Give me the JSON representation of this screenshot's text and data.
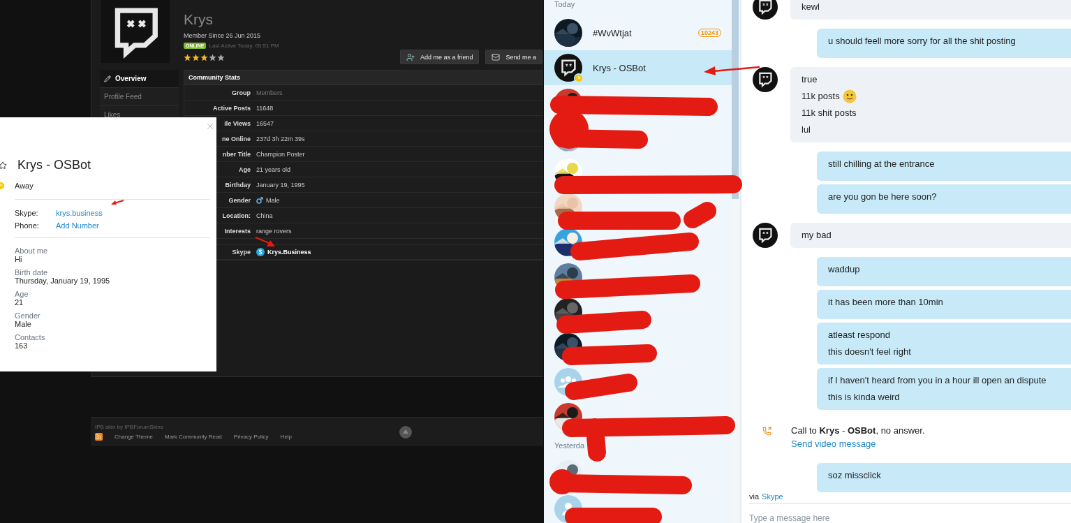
{
  "forum": {
    "username": "Krys",
    "member_since": "Member Since 26 Jun 2015",
    "online": true,
    "status_badge": "ONLINE",
    "last_active": "Last Active Today, 05:51 PM",
    "stars": 3,
    "buttons": [
      {
        "label": "Add me as a friend",
        "kind": "friend"
      },
      {
        "label": "Send me a",
        "kind": "message"
      }
    ],
    "sidebar": [
      {
        "label": "Overview",
        "selected": true
      },
      {
        "label": "Profile Feed",
        "selected": false
      },
      {
        "label": "Likes",
        "selected": false
      }
    ],
    "stats": {
      "title": "Community Stats",
      "rows": [
        {
          "label": "Group",
          "value": "Members",
          "kind": "muted"
        },
        {
          "label": "Active Posts",
          "value": "11648",
          "kind": "plain"
        },
        {
          "label": "ile Views",
          "value": "16547",
          "kind": "plain"
        },
        {
          "label": "ne Online",
          "value": "237d 3h 22m 39s",
          "kind": "plain"
        },
        {
          "label": "nber Title",
          "value": "Champion Poster",
          "kind": "plain"
        },
        {
          "label": "Age",
          "value": "21 years old",
          "kind": "plain"
        },
        {
          "label": "Birthday",
          "value": "January 19, 1995",
          "kind": "plain"
        },
        {
          "label": "Gender",
          "value": "Male",
          "kind": "gender"
        },
        {
          "label": "Location:",
          "value": "China",
          "kind": "plain"
        },
        {
          "label": "Interests",
          "value": "range rovers",
          "kind": "plain"
        },
        {
          "label": "Skype",
          "value": "Krys.Business",
          "kind": "skype"
        }
      ]
    },
    "footer": {
      "credit": "IPB skin by IPBForumSkins",
      "links": [
        "Change Theme",
        "Mark Community Read",
        "Privacy Policy",
        "Help"
      ]
    }
  },
  "profile_card": {
    "name": "Krys - OSBot",
    "status": "Away",
    "contacts": [
      {
        "label": "Skype:",
        "value": "krys.business"
      },
      {
        "label": "Phone:",
        "value": "Add Number"
      }
    ],
    "fields": [
      {
        "label": "About me",
        "value": "Hi"
      },
      {
        "label": "Birth date",
        "value": "Thursday, January 19, 1995"
      },
      {
        "label": "Age",
        "value": "21"
      },
      {
        "label": "Gender",
        "value": "Male"
      },
      {
        "label": "Contacts",
        "value": "163"
      }
    ]
  },
  "contacts": {
    "today_label": "Today",
    "today": [
      {
        "name": "#WvWtjat",
        "badge": "10243",
        "kind": "picture",
        "selected": false,
        "away": false
      },
      {
        "name": "Krys - OSBot",
        "kind": "logo",
        "selected": true,
        "away": true
      },
      {
        "kind": "picture",
        "selected": false,
        "away": false
      },
      {
        "kind": "picture",
        "selected": false,
        "away": false
      },
      {
        "kind": "picture",
        "selected": false,
        "away": false
      },
      {
        "kind": "picture",
        "selected": false,
        "away": false
      },
      {
        "kind": "picture",
        "selected": false,
        "away": false
      },
      {
        "kind": "picture",
        "selected": false,
        "away": false
      },
      {
        "kind": "picture",
        "selected": false,
        "away": false
      },
      {
        "kind": "picture",
        "selected": false,
        "away": false
      },
      {
        "kind": "group",
        "selected": false,
        "away": false
      },
      {
        "kind": "picture",
        "selected": false,
        "away": false
      }
    ],
    "yesterday_label": "Yesterda",
    "yesterday": [
      {
        "kind": "picture",
        "selected": false,
        "away": false
      },
      {
        "kind": "person",
        "selected": false,
        "away": false
      }
    ]
  },
  "chat": {
    "messages": [
      {
        "kind": "incoming",
        "lines": [
          {
            "text": "kewl",
            "emoji": false
          }
        ]
      },
      {
        "kind": "outgoing",
        "lines": [
          {
            "text": "u should feell more sorry for all the shit posting",
            "emoji": false
          }
        ]
      },
      {
        "kind": "incoming",
        "lines": [
          {
            "text": "true",
            "emoji": false
          },
          {
            "text": "11k posts",
            "emoji": true
          },
          {
            "text": "11k shit posts",
            "emoji": false
          },
          {
            "text": "lul",
            "emoji": false
          }
        ]
      },
      {
        "kind": "outgoing",
        "lines": [
          {
            "text": "still chilling at the entrance",
            "emoji": false
          }
        ]
      },
      {
        "kind": "outgoing",
        "lines": [
          {
            "text": "are you gon be here soon?",
            "emoji": false
          }
        ]
      },
      {
        "kind": "incoming",
        "lines": [
          {
            "text": "my bad",
            "emoji": false
          }
        ]
      },
      {
        "kind": "outgoing",
        "lines": [
          {
            "text": "waddup",
            "emoji": false
          }
        ]
      },
      {
        "kind": "outgoing",
        "lines": [
          {
            "text": "it has been more than 10min",
            "emoji": false
          }
        ]
      },
      {
        "kind": "outgoing",
        "lines": [
          {
            "text": "atleast respond",
            "emoji": false
          },
          {
            "text": "this doesn't feel right",
            "emoji": false
          }
        ]
      },
      {
        "kind": "outgoing",
        "lines": [
          {
            "text": "if I haven't heard from you in a hour ill open an dispute",
            "emoji": false
          },
          {
            "text": "this is kinda weird",
            "emoji": false
          }
        ]
      },
      {
        "kind": "call",
        "text": "Call to **Krys** - **OSBot**, no answer.",
        "link": "Send video message"
      },
      {
        "kind": "outgoing",
        "lines": [
          {
            "text": "soz missclick",
            "emoji": false
          }
        ]
      }
    ],
    "via": "via",
    "service": "Skype",
    "composer": {
      "placeholder": "Type a message here"
    }
  }
}
